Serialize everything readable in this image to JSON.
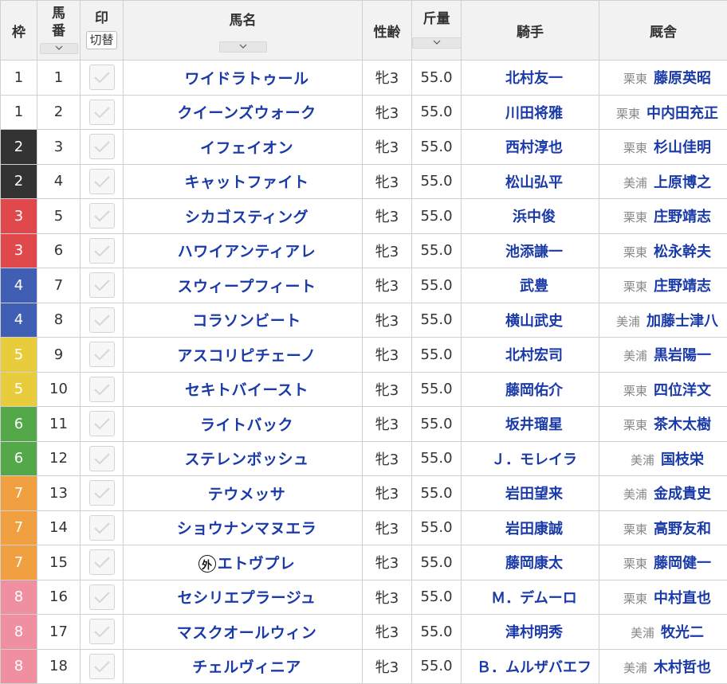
{
  "headers": {
    "waku": "枠",
    "umaban_line1": "馬",
    "umaban_line2": "番",
    "mark": "印",
    "mark_toggle": "切替",
    "horse_name": "馬名",
    "sex_age": "性齢",
    "weight": "斤量",
    "jockey": "騎手",
    "stable": "厩舎"
  },
  "waku_colors": {
    "1": {
      "bg": "#ffffff",
      "fg": "#333333"
    },
    "2": {
      "bg": "#333333",
      "fg": "#ffffff"
    },
    "3": {
      "bg": "#e0484c",
      "fg": "#ffffff"
    },
    "4": {
      "bg": "#3f5eb4",
      "fg": "#ffffff"
    },
    "5": {
      "bg": "#e8cc3c",
      "fg": "#ffffff"
    },
    "6": {
      "bg": "#55a84a",
      "fg": "#ffffff"
    },
    "7": {
      "bg": "#f0a040",
      "fg": "#ffffff"
    },
    "8": {
      "bg": "#ef8fa0",
      "fg": "#ffffff"
    }
  },
  "rows": [
    {
      "waku": "1",
      "umaban": "1",
      "prefix": "",
      "name": "ワイドラトゥール",
      "sex_age": "牝3",
      "weight": "55.0",
      "jockey": "北村友一",
      "region": "栗東",
      "trainer": "藤原英昭"
    },
    {
      "waku": "1",
      "umaban": "2",
      "prefix": "",
      "name": "クイーンズウォーク",
      "sex_age": "牝3",
      "weight": "55.0",
      "jockey": "川田将雅",
      "region": "栗東",
      "trainer": "中内田充正"
    },
    {
      "waku": "2",
      "umaban": "3",
      "prefix": "",
      "name": "イフェイオン",
      "sex_age": "牝3",
      "weight": "55.0",
      "jockey": "西村淳也",
      "region": "栗東",
      "trainer": "杉山佳明"
    },
    {
      "waku": "2",
      "umaban": "4",
      "prefix": "",
      "name": "キャットファイト",
      "sex_age": "牝3",
      "weight": "55.0",
      "jockey": "松山弘平",
      "region": "美浦",
      "trainer": "上原博之"
    },
    {
      "waku": "3",
      "umaban": "5",
      "prefix": "",
      "name": "シカゴスティング",
      "sex_age": "牝3",
      "weight": "55.0",
      "jockey": "浜中俊",
      "region": "栗東",
      "trainer": "庄野靖志"
    },
    {
      "waku": "3",
      "umaban": "6",
      "prefix": "",
      "name": "ハワイアンティアレ",
      "sex_age": "牝3",
      "weight": "55.0",
      "jockey": "池添謙一",
      "region": "栗東",
      "trainer": "松永幹夫"
    },
    {
      "waku": "4",
      "umaban": "7",
      "prefix": "",
      "name": "スウィープフィート",
      "sex_age": "牝3",
      "weight": "55.0",
      "jockey": "武豊",
      "region": "栗東",
      "trainer": "庄野靖志"
    },
    {
      "waku": "4",
      "umaban": "8",
      "prefix": "",
      "name": "コラソンビート",
      "sex_age": "牝3",
      "weight": "55.0",
      "jockey": "横山武史",
      "region": "美浦",
      "trainer": "加藤士津八"
    },
    {
      "waku": "5",
      "umaban": "9",
      "prefix": "",
      "name": "アスコリピチェーノ",
      "sex_age": "牝3",
      "weight": "55.0",
      "jockey": "北村宏司",
      "region": "美浦",
      "trainer": "黒岩陽一"
    },
    {
      "waku": "5",
      "umaban": "10",
      "prefix": "",
      "name": "セキトバイースト",
      "sex_age": "牝3",
      "weight": "55.0",
      "jockey": "藤岡佑介",
      "region": "栗東",
      "trainer": "四位洋文"
    },
    {
      "waku": "6",
      "umaban": "11",
      "prefix": "",
      "name": "ライトバック",
      "sex_age": "牝3",
      "weight": "55.0",
      "jockey": "坂井瑠星",
      "region": "栗東",
      "trainer": "茶木太樹"
    },
    {
      "waku": "6",
      "umaban": "12",
      "prefix": "",
      "name": "ステレンボッシュ",
      "sex_age": "牝3",
      "weight": "55.0",
      "jockey": "Ｊ．モレイラ",
      "region": "美浦",
      "trainer": "国枝栄"
    },
    {
      "waku": "7",
      "umaban": "13",
      "prefix": "",
      "name": "テウメッサ",
      "sex_age": "牝3",
      "weight": "55.0",
      "jockey": "岩田望来",
      "region": "美浦",
      "trainer": "金成貴史"
    },
    {
      "waku": "7",
      "umaban": "14",
      "prefix": "",
      "name": "ショウナンマヌエラ",
      "sex_age": "牝3",
      "weight": "55.0",
      "jockey": "岩田康誠",
      "region": "栗東",
      "trainer": "高野友和"
    },
    {
      "waku": "7",
      "umaban": "15",
      "prefix": "外",
      "name": "エトヴプレ",
      "sex_age": "牝3",
      "weight": "55.0",
      "jockey": "藤岡康太",
      "region": "栗東",
      "trainer": "藤岡健一"
    },
    {
      "waku": "8",
      "umaban": "16",
      "prefix": "",
      "name": "セシリエプラージュ",
      "sex_age": "牝3",
      "weight": "55.0",
      "jockey": "Ｍ．デムーロ",
      "region": "栗東",
      "trainer": "中村直也"
    },
    {
      "waku": "8",
      "umaban": "17",
      "prefix": "",
      "name": "マスクオールウィン",
      "sex_age": "牝3",
      "weight": "55.0",
      "jockey": "津村明秀",
      "region": "美浦",
      "trainer": "牧光二"
    },
    {
      "waku": "8",
      "umaban": "18",
      "prefix": "",
      "name": "チェルヴィニア",
      "sex_age": "牝3",
      "weight": "55.0",
      "jockey": "Ｂ．ムルザバエフ",
      "region": "美浦",
      "trainer": "木村哲也"
    }
  ]
}
